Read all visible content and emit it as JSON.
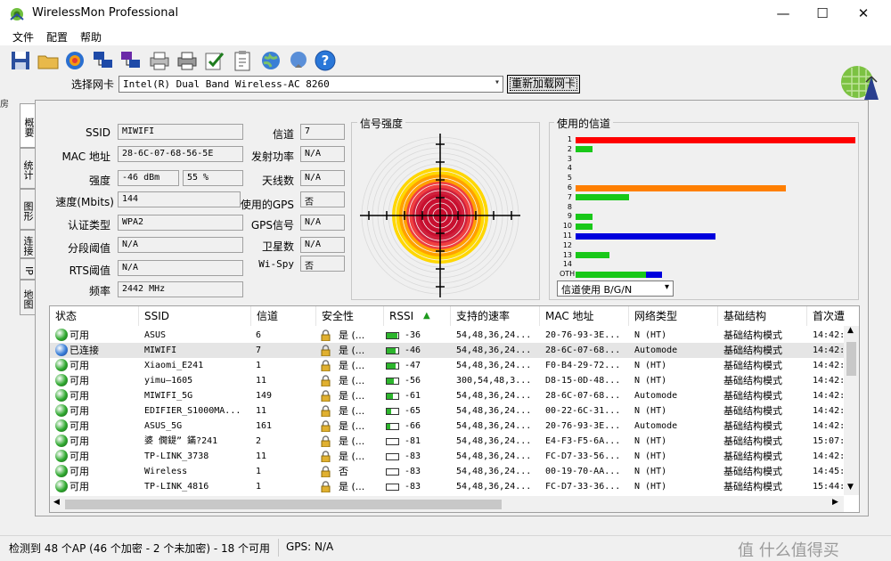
{
  "window": {
    "title": "WirelessMon Professional",
    "minimize": "—",
    "maximize": "☐",
    "close": "✕"
  },
  "menu": [
    {
      "label": "文件"
    },
    {
      "label": "配置"
    },
    {
      "label": "帮助"
    }
  ],
  "toolbar": [
    "save-icon",
    "open-folder-icon",
    "record-icon",
    "network-icon",
    "network-log-icon",
    "print-icon",
    "print-setup-icon",
    "check-icon",
    "clipboard-icon",
    "globe-icon",
    "globe-settings-icon",
    "help-icon"
  ],
  "adapter": {
    "label": "选择网卡",
    "value": "Intel(R) Dual Band Wireless-AC 8260",
    "reload": "重新加载网卡"
  },
  "tabs": [
    {
      "label": "概要"
    },
    {
      "label": "统计"
    },
    {
      "label": "图形"
    },
    {
      "label": "连接"
    },
    {
      "label": "IP"
    },
    {
      "label": "地图"
    }
  ],
  "info": {
    "ssid_label": "SSID",
    "ssid": "MIWIFI",
    "mac_label": "MAC 地址",
    "mac": "28-6C-07-68-56-5E",
    "strength_label": "强度",
    "strength_dbm": "-46 dBm",
    "strength_pct": "55 %",
    "speed_label": "速度(Mbits)",
    "speed": "144",
    "auth_label": "认证类型",
    "auth": "WPA2",
    "frag_label": "分段阈值",
    "frag": "N/A",
    "rts_label": "RTS阈值",
    "rts": "N/A",
    "freq_label": "频率",
    "freq": "2442 MHz",
    "channel_label": "信道",
    "channel": "7",
    "txpower_label": "发射功率",
    "txpower": "N/A",
    "antenna_label": "天线数",
    "antenna": "N/A",
    "usegps_label": "使用的GPS",
    "usegps": "否",
    "gpssignal_label": "GPS信号",
    "gpssignal": "N/A",
    "satellites_label": "卫星数",
    "satellites": "N/A",
    "wispy_label": "Wi-Spy",
    "wispy": "否"
  },
  "signal_panel": {
    "title": "信号强度"
  },
  "channel_panel": {
    "title": "使用的信道",
    "select": "信道使用 B/G/N",
    "channels": [
      {
        "label": "1",
        "red": 1.0,
        "green": 0
      },
      {
        "label": "2",
        "red": 0,
        "green": 0.06
      },
      {
        "label": "3",
        "red": 0,
        "green": 0
      },
      {
        "label": "4",
        "red": 0,
        "green": 0
      },
      {
        "label": "5",
        "red": 0,
        "green": 0
      },
      {
        "label": "6",
        "orange": 0.75,
        "green": 0
      },
      {
        "label": "7",
        "red": 0,
        "green": 0.19
      },
      {
        "label": "8",
        "red": 0,
        "green": 0
      },
      {
        "label": "9",
        "red": 0,
        "green": 0.06
      },
      {
        "label": "10",
        "red": 0,
        "green": 0.06
      },
      {
        "label": "11",
        "blue": 0.5,
        "green": 0
      },
      {
        "label": "12",
        "red": 0,
        "green": 0
      },
      {
        "label": "13",
        "red": 0,
        "green": 0.12
      },
      {
        "label": "14",
        "red": 0,
        "green": 0
      },
      {
        "label": "OTH",
        "green": 0.25,
        "blue_after": 0.06
      }
    ]
  },
  "list": {
    "columns": [
      "状态",
      "SSID",
      "信道",
      "安全性",
      "RSSI",
      "支持的速率",
      "MAC 地址",
      "网络类型",
      "基础结构",
      "首次遭"
    ],
    "rows": [
      {
        "status": "可用",
        "color": "green",
        "ssid": "ASUS",
        "channel": "6",
        "sec": "是 (...",
        "rssi": "-36",
        "rates": "54,48,36,24...",
        "mac": "20-76-93-3E...",
        "type": "N (HT)",
        "infra": "基础结构模式",
        "first": "14:42:",
        "sig": 0.9,
        "selected": false
      },
      {
        "status": "已连接",
        "color": "blue",
        "ssid": "MIWIFI",
        "channel": "7",
        "sec": "是 (...",
        "rssi": "-46",
        "rates": "54,48,36,24...",
        "mac": "28-6C-07-68...",
        "type": "Automode",
        "infra": "基础结构模式",
        "first": "14:42:",
        "sig": 0.8,
        "selected": true
      },
      {
        "status": "可用",
        "color": "green",
        "ssid": "Xiaomi_E241",
        "channel": "1",
        "sec": "是 (...",
        "rssi": "-47",
        "rates": "54,48,36,24...",
        "mac": "F0-B4-29-72...",
        "type": "N (HT)",
        "infra": "基础结构模式",
        "first": "14:42:",
        "sig": 0.8,
        "selected": false
      },
      {
        "status": "可用",
        "color": "green",
        "ssid": "yimu—1605",
        "channel": "11",
        "sec": "是 (...",
        "rssi": "-56",
        "rates": "300,54,48,3...",
        "mac": "D8-15-0D-48...",
        "type": "N (HT)",
        "infra": "基础结构模式",
        "first": "14:42:",
        "sig": 0.6,
        "selected": false
      },
      {
        "status": "可用",
        "color": "green",
        "ssid": "MIWIFI_5G",
        "channel": "149",
        "sec": "是 (...",
        "rssi": "-61",
        "rates": "54,48,36,24...",
        "mac": "28-6C-07-68...",
        "type": "Automode",
        "infra": "基础结构模式",
        "first": "14:42:",
        "sig": 0.5,
        "selected": false
      },
      {
        "status": "可用",
        "color": "green",
        "ssid": "EDIFIER_S1000MA...",
        "channel": "11",
        "sec": "是 (...",
        "rssi": "-65",
        "rates": "54,48,36,24...",
        "mac": "00-22-6C-31...",
        "type": "N (HT)",
        "infra": "基础结构模式",
        "first": "14:42:",
        "sig": 0.35,
        "selected": false
      },
      {
        "status": "可用",
        "color": "green",
        "ssid": "ASUS_5G",
        "channel": "161",
        "sec": "是 (...",
        "rssi": "-66",
        "rates": "54,48,36,24...",
        "mac": "20-76-93-3E...",
        "type": "Automode",
        "infra": "基础结构模式",
        "first": "14:42:",
        "sig": 0.3,
        "selected": false
      },
      {
        "status": "可用",
        "color": "green",
        "ssid": "婆 僩鍉” 鏋?241",
        "channel": "2",
        "sec": "是 (...",
        "rssi": "-81",
        "rates": "54,48,36,24...",
        "mac": "E4-F3-F5-6A...",
        "type": "N (HT)",
        "infra": "基础结构模式",
        "first": "15:07:",
        "sig": 0,
        "selected": false
      },
      {
        "status": "可用",
        "color": "green",
        "ssid": "TP-LINK_3738",
        "channel": "11",
        "sec": "是 (...",
        "rssi": "-83",
        "rates": "54,48,36,24...",
        "mac": "FC-D7-33-56...",
        "type": "N (HT)",
        "infra": "基础结构模式",
        "first": "14:42:",
        "sig": 0,
        "selected": false
      },
      {
        "status": "可用",
        "color": "green",
        "ssid": "Wireless",
        "channel": "1",
        "sec": "否",
        "rssi": "-83",
        "rates": "54,48,36,24...",
        "mac": "00-19-70-AA...",
        "type": "N (HT)",
        "infra": "基础结构模式",
        "first": "14:45:",
        "sig": 0,
        "selected": false
      },
      {
        "status": "可用",
        "color": "green",
        "ssid": "TP-LINK_4816",
        "channel": "1",
        "sec": "是 (...",
        "rssi": "-83",
        "rates": "54,48,36,24...",
        "mac": "FC-D7-33-36...",
        "type": "N (HT)",
        "infra": "基础结构模式",
        "first": "15:44:",
        "sig": 0,
        "selected": false
      }
    ]
  },
  "status": {
    "left": "检测到 48 个AP (46 个加密 - 2 个未加密) - 18 个可用",
    "gps": "GPS: N/A",
    "watermark": "值 什么值得买"
  },
  "colors": {
    "accent": "#3399ff",
    "red": "#ff0000",
    "green": "#19c819",
    "orange": "#ff7f00",
    "blue": "#0000dd"
  }
}
